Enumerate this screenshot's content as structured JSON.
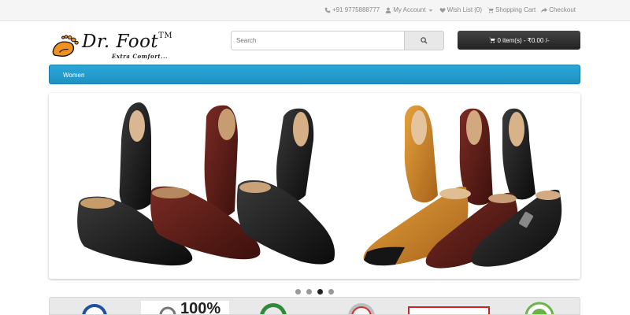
{
  "topbar": {
    "phone": "+91 9775888777",
    "my_account": "My Account",
    "wishlist": "Wish List (0)",
    "shopping_cart": "Shopping Cart",
    "checkout": "Checkout"
  },
  "header": {
    "logo_name": "Dr. Foot",
    "logo_mark": "TM",
    "logo_tagline": "Extra Comfort...",
    "search_placeholder": "Search",
    "cart_label": "0 item(s) - ₹0.00 /-"
  },
  "menu": {
    "items": [
      "Women"
    ]
  },
  "slideshow": {
    "total_slides": 4,
    "active_slide": 3
  },
  "badges": {
    "visible_text": "100%"
  },
  "colors": {
    "nav": "#1f90c2",
    "cart": "#2b2b2b",
    "accent_orange": "#f0901e"
  },
  "icons": [
    "phone-icon",
    "user-icon",
    "heart-icon",
    "cart-icon",
    "share-icon",
    "search-icon"
  ]
}
